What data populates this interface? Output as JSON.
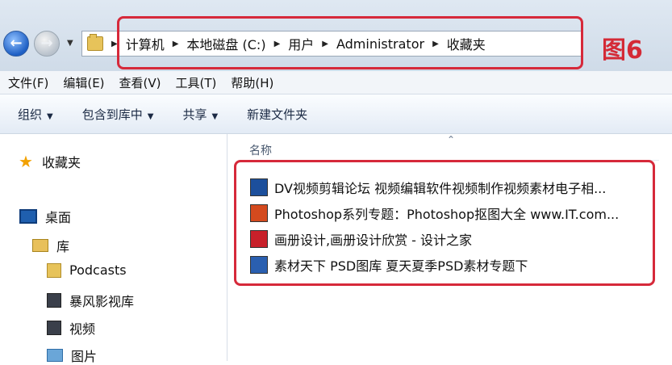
{
  "address_bar": {
    "crumbs": [
      "计算机",
      "本地磁盘 (C:)",
      "用户",
      "Administrator",
      "收藏夹"
    ]
  },
  "annotation_label": "图6",
  "menu": [
    "文件(F)",
    "编辑(E)",
    "查看(V)",
    "工具(T)",
    "帮助(H)"
  ],
  "toolbar": {
    "organize": "组织",
    "include_library": "包含到库中",
    "share": "共享",
    "new_folder": "新建文件夹"
  },
  "nav_pane": {
    "favorites": "收藏夹",
    "desktop": "桌面",
    "libraries": "库",
    "podcasts": "Podcasts",
    "storm_library": "暴风影视库",
    "videos": "视频",
    "pictures": "图片"
  },
  "content": {
    "column_header": "名称",
    "favorites": [
      {
        "label": "DV视频剪辑论坛 视频编辑软件视频制作视频素材电子相...",
        "icon": "dv-site-icon",
        "color": "#1c4f9c"
      },
      {
        "label": "Photoshop系列专题：Photoshop抠图大全 www.IT.com...",
        "icon": "photoshop-site-icon",
        "color": "#d44a1e"
      },
      {
        "label": "画册设计,画册设计欣赏 - 设计之家",
        "icon": "design-home-icon",
        "color": "#c8202a"
      },
      {
        "label": "素材天下  PSD图库  夏天夏季PSD素材专题下",
        "icon": "sucai-site-icon",
        "color": "#2a5fb0"
      }
    ]
  },
  "colors": {
    "highlight_red": "#d6293a"
  }
}
